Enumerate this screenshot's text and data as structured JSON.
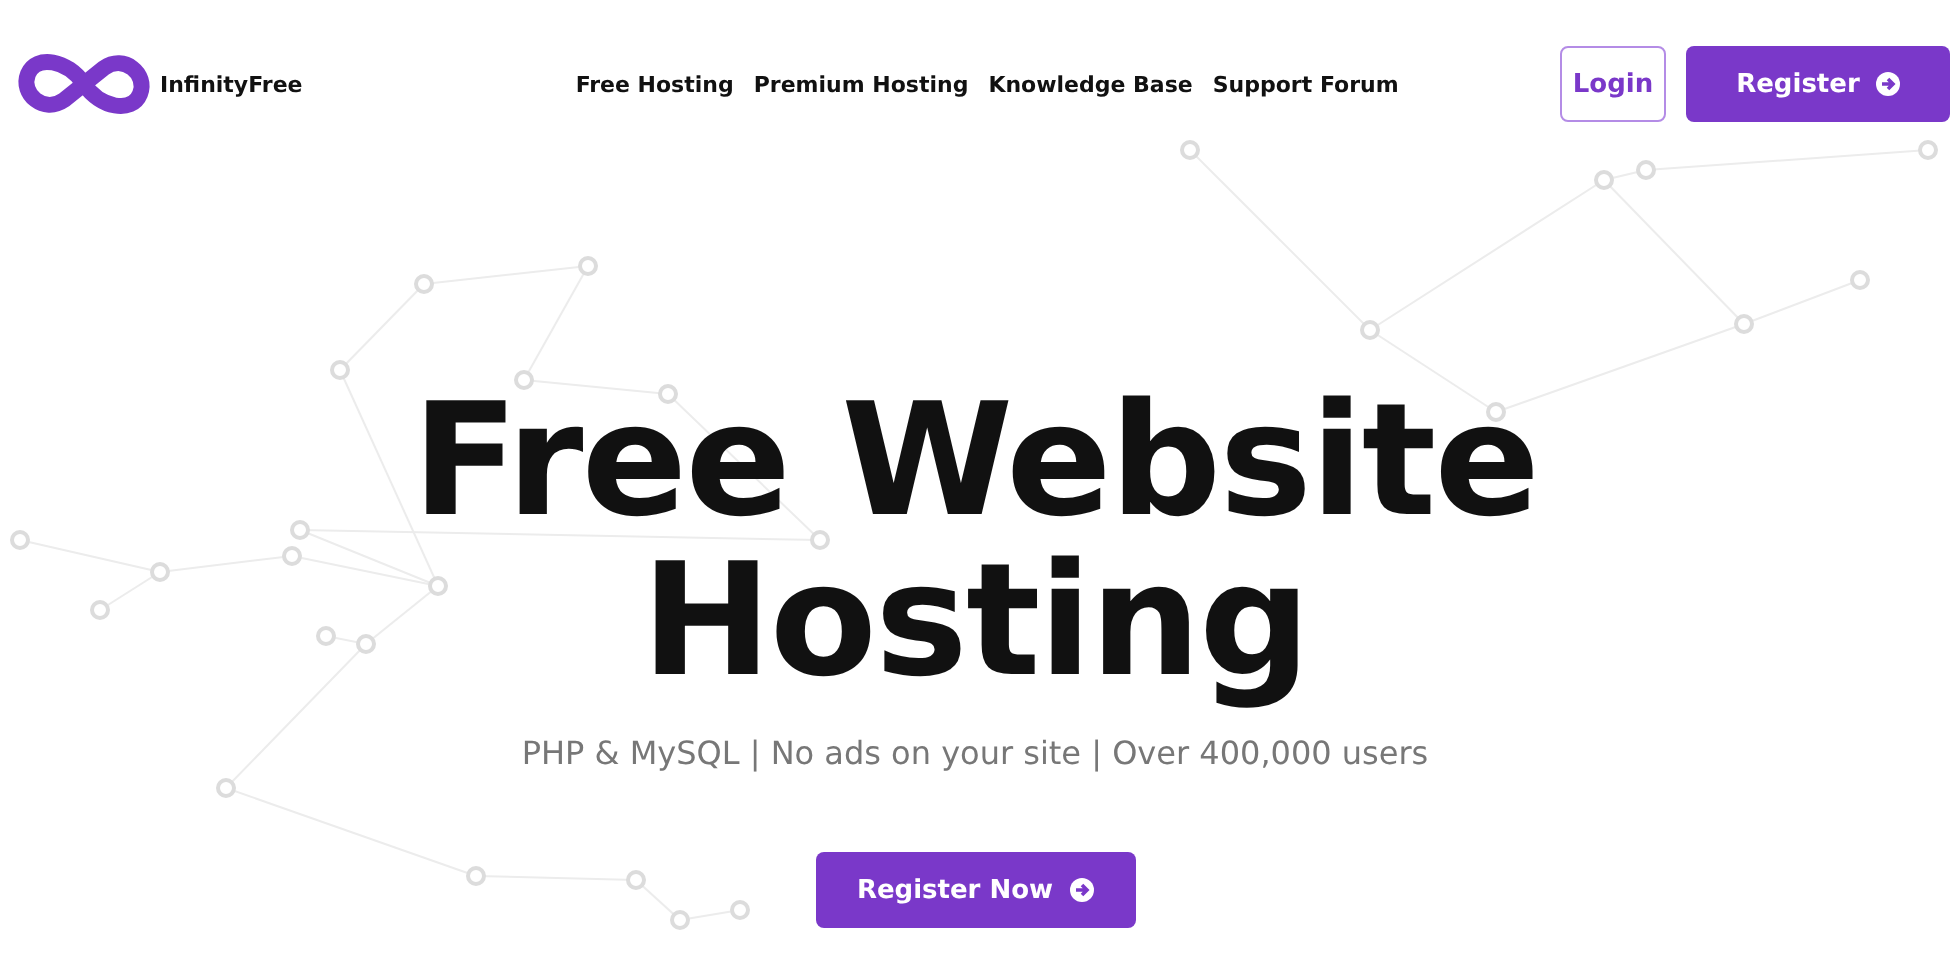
{
  "brand": {
    "name": "InfinityFree"
  },
  "nav": [
    "Free Hosting",
    "Premium Hosting",
    "Knowledge Base",
    "Support Forum"
  ],
  "header_buttons": [
    {
      "label": "Login",
      "kind": "outline"
    },
    {
      "label": "Register",
      "kind": "filled"
    }
  ],
  "hero": {
    "title_lines": [
      "Free Website",
      "Hosting"
    ],
    "subtitle": "PHP & MySQL | No ads on your site | Over 400,000 users",
    "cta": {
      "label": "Register Now"
    }
  }
}
